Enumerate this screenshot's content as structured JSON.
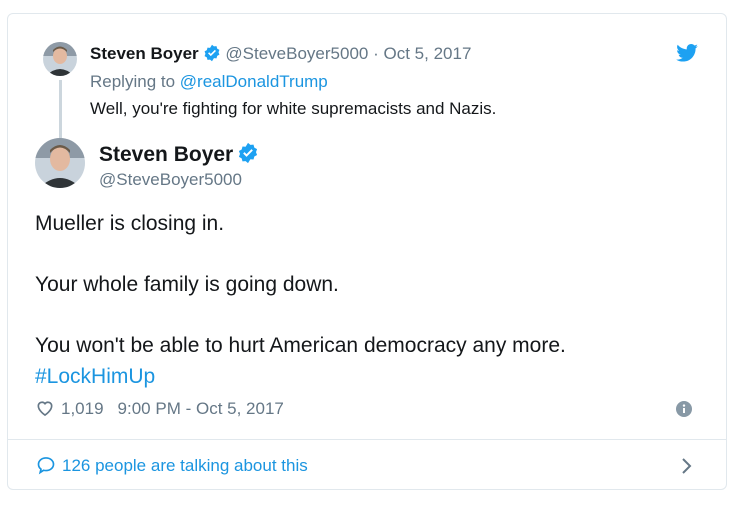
{
  "colors": {
    "accent": "#1b95e0",
    "muted": "#657786",
    "text": "#14171a",
    "border": "#e1e8ed"
  },
  "parent_tweet": {
    "name": "Steven Boyer",
    "handle": "@SteveBoyer5000",
    "separator": "·",
    "date": "Oct 5, 2017",
    "replying_prefix": "Replying to",
    "replying_to": "@realDonaldTrump",
    "text": "Well, you're fighting for white supremacists and Nazis."
  },
  "main_tweet": {
    "name": "Steven Boyer",
    "handle": "@SteveBoyer5000",
    "lines": [
      "Mueller is closing in.",
      "Your whole family is going down.",
      "You won't be able to hurt American democracy any more."
    ],
    "hashtag": "#LockHimUp",
    "likes": "1,019",
    "timestamp": "9:00 PM - Oct 5, 2017"
  },
  "footer": {
    "talking_text": "126 people are talking about this"
  },
  "icons": {
    "brand": "twitter-bird-icon",
    "verified": "verified-badge-icon",
    "like": "heart-icon",
    "info": "info-icon",
    "reply": "speech-bubble-icon",
    "more": "chevron-right-icon"
  }
}
